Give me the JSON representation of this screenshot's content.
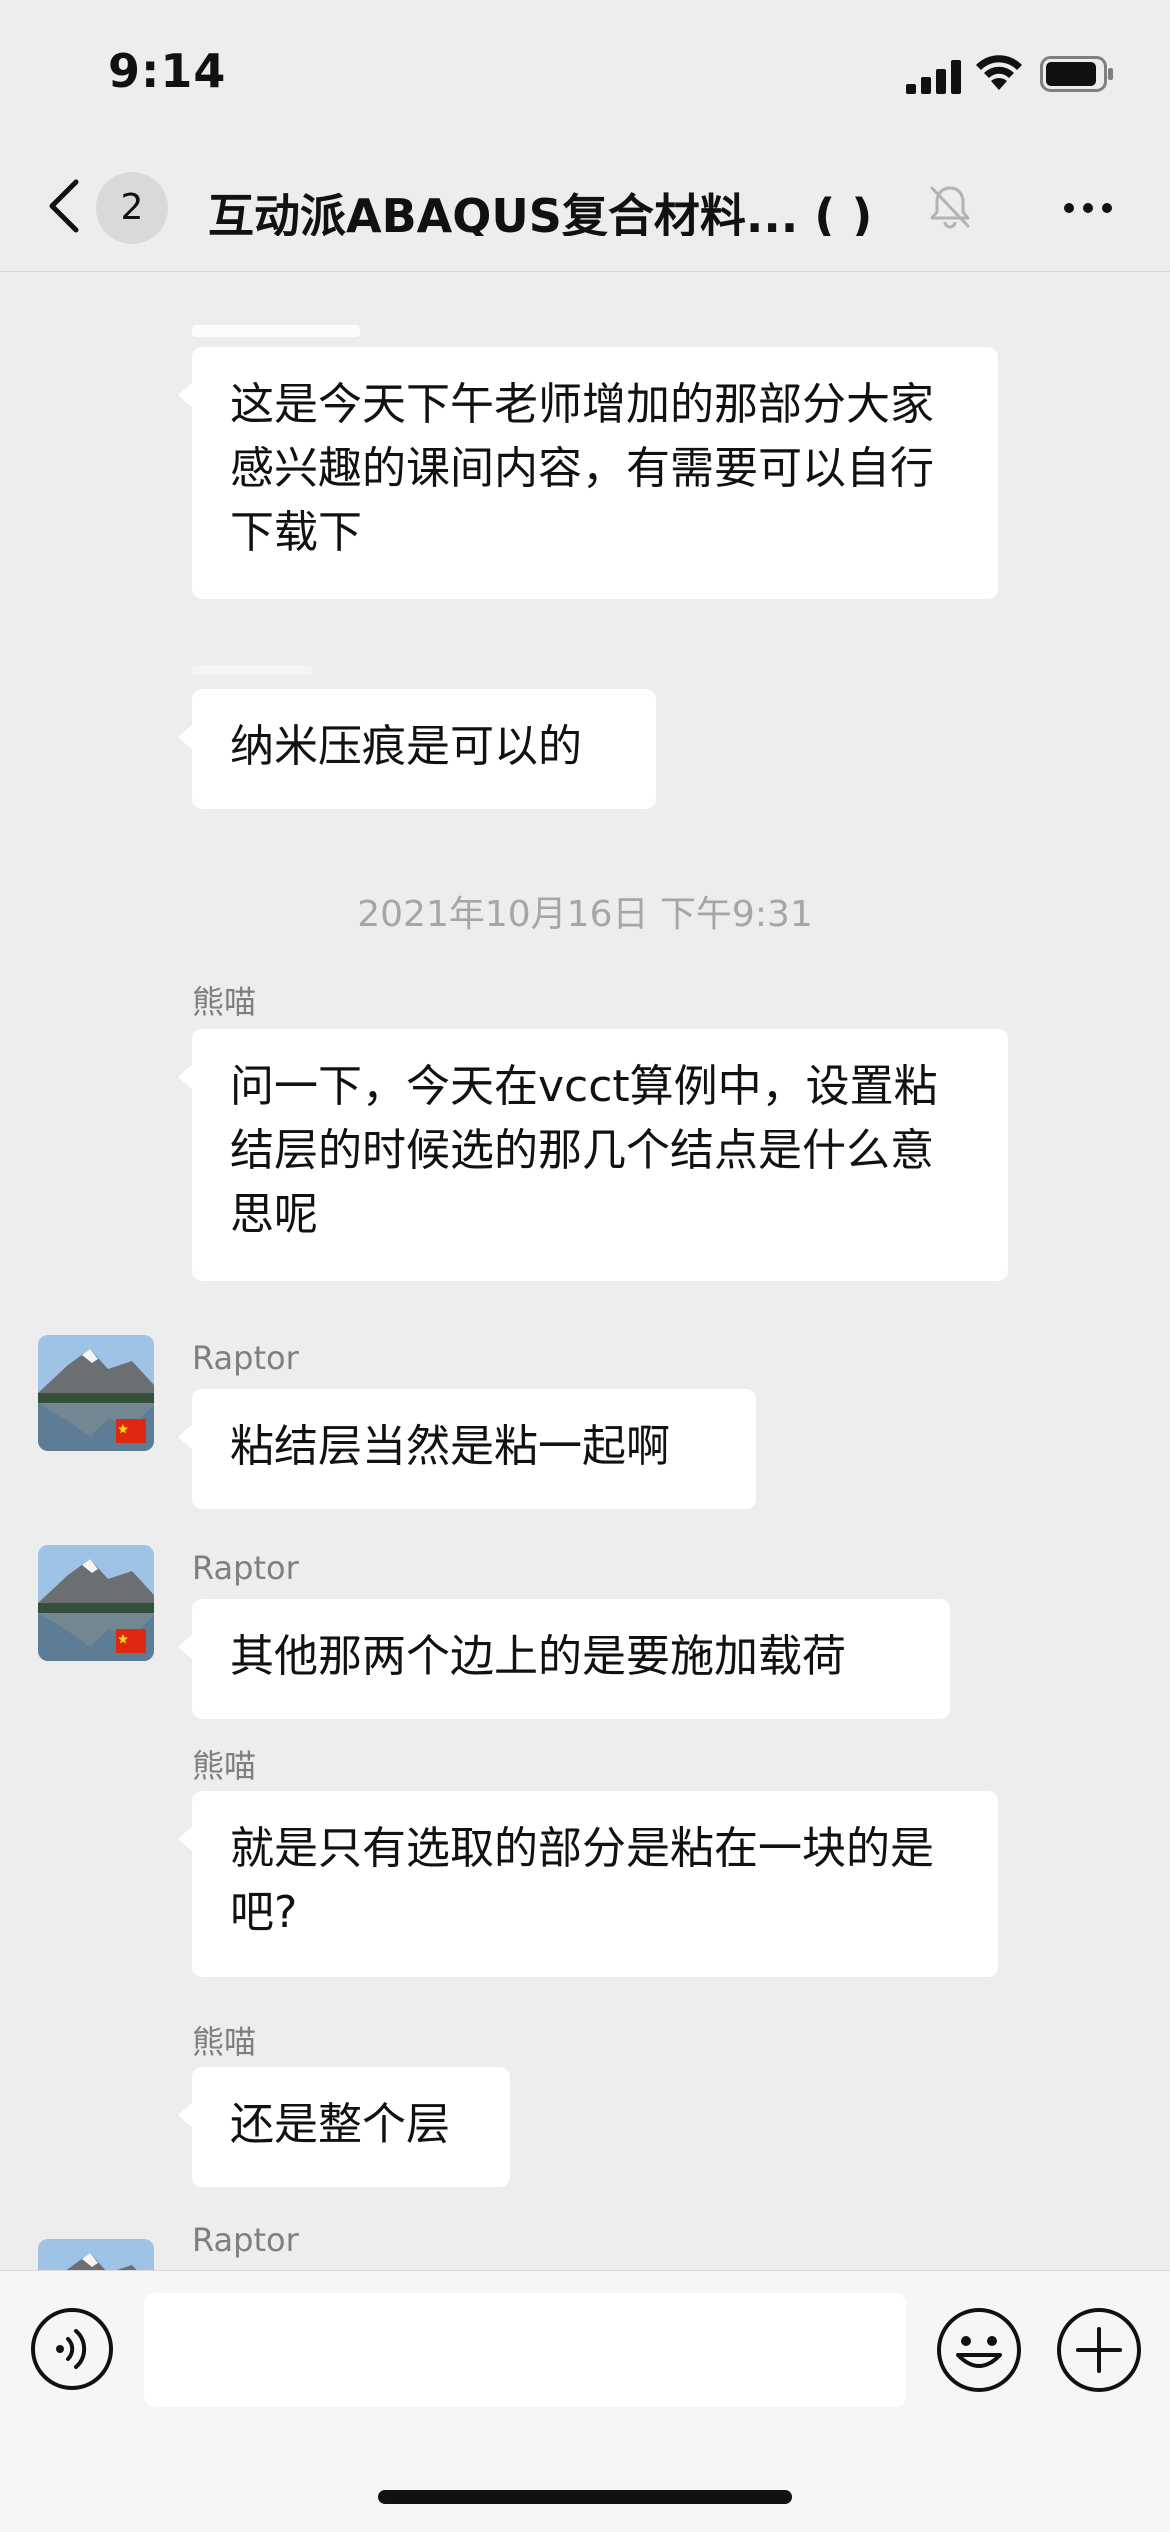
{
  "status_bar": {
    "time": "9:14"
  },
  "nav": {
    "unread_count": "2",
    "title": "互动派ABAQUS复合材料... (    )"
  },
  "messages": [
    {
      "sender": "",
      "text": "这是今天下午老师增加的那部分大家感兴趣的课间内容，有需要可以自行下载下"
    },
    {
      "sender": "",
      "text": "纳米压痕是可以的"
    },
    {
      "timestamp": "2021年10月16日 下午9:31"
    },
    {
      "sender": "熊喵",
      "text": "问一下，今天在vcct算例中，设置粘结层的时候选的那几个结点是什么意思呢"
    },
    {
      "sender": "Raptor",
      "text": "粘结层当然是粘一起啊"
    },
    {
      "sender": "Raptor",
      "text": "其他那两个边上的是要施加载荷"
    },
    {
      "sender": "熊喵",
      "text": "就是只有选取的部分是粘在一块的是吧?"
    },
    {
      "sender": "熊喵",
      "text": "还是整个层"
    },
    {
      "sender": "Raptor",
      "text": ""
    }
  ],
  "input": {
    "placeholder": ""
  },
  "colors": {
    "background": "#ededed",
    "bubble": "#ffffff",
    "sender_name": "#7f7f7f",
    "timestamp": "#a6a6a6"
  },
  "icons": [
    "back-icon",
    "mute-icon",
    "more-icon",
    "voice-icon",
    "emoji-icon",
    "plus-icon",
    "signal-icon",
    "wifi-icon",
    "battery-icon"
  ]
}
